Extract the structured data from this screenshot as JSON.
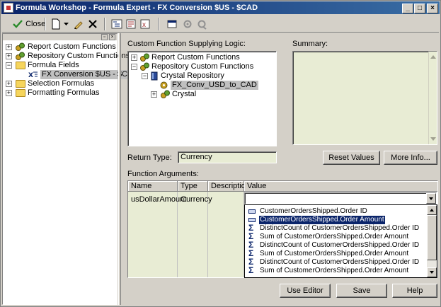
{
  "window": {
    "title": "Formula Workshop - Formula Expert - FX Conversion $US - $CAD",
    "minimize": "_",
    "maximize": "□",
    "close": "×"
  },
  "toolbar": {
    "close_label": "Close"
  },
  "left_tree": [
    {
      "label": "Report Custom Functions",
      "expander": "+",
      "icon": "functions-icon"
    },
    {
      "label": "Repository Custom Functions",
      "expander": "+",
      "icon": "functions-icon"
    },
    {
      "label": "Formula Fields",
      "expander": "−",
      "icon": "folder-icon"
    },
    {
      "label": "FX Conversion $US - $CAD",
      "expander": "",
      "icon": "formula-icon",
      "selected": true
    },
    {
      "label": "Selection Formulas",
      "expander": "+",
      "icon": "folder-icon"
    },
    {
      "label": "Formatting Formulas",
      "expander": "+",
      "icon": "folder-icon"
    }
  ],
  "cf_panel": {
    "label": "Custom Function Supplying Logic:",
    "tree": [
      {
        "label": "Report Custom Functions",
        "expander": "+"
      },
      {
        "label": "Repository Custom Functions",
        "expander": "−"
      },
      {
        "label": "Crystal Repository",
        "expander": "−"
      },
      {
        "label": "FX_Conv_USD_to_CAD",
        "expander": "",
        "selected": true
      },
      {
        "label": "Crystal",
        "expander": "+"
      }
    ]
  },
  "summary": {
    "label": "Summary:"
  },
  "return_type": {
    "label": "Return Type:",
    "value": "Currency"
  },
  "buttons": {
    "reset_values": "Reset Values",
    "more_info": "More Info...",
    "use_editor": "Use Editor",
    "save": "Save",
    "help": "Help"
  },
  "function_arguments": {
    "label": "Function Arguments:",
    "columns": [
      "Name",
      "Type",
      "Description",
      "Value"
    ],
    "rows": [
      {
        "name": "usDollarAmount",
        "type": "Currency",
        "description": "",
        "value": ""
      }
    ]
  },
  "dropdown_items": [
    {
      "icon": "field-icon",
      "text": "CustomerOrdersShipped.Order ID"
    },
    {
      "icon": "field-icon",
      "text": "CustomerOrdersShipped.Order Amount",
      "highlighted": true
    },
    {
      "icon": "sigma-icon",
      "text": "DistinctCount of CustomerOrdersShipped.Order ID"
    },
    {
      "icon": "sigma-icon",
      "text": "Sum of CustomerOrdersShipped.Order Amount"
    },
    {
      "icon": "sigma-icon",
      "text": "DistinctCount of CustomerOrdersShipped.Order ID"
    },
    {
      "icon": "sigma-icon",
      "text": "Sum of CustomerOrdersShipped.Order Amount"
    },
    {
      "icon": "sigma-icon",
      "text": "DistinctCount of CustomerOrdersShipped.Order ID"
    },
    {
      "icon": "sigma-icon",
      "text": "Sum of CustomerOrdersShipped.Order Amount"
    }
  ],
  "colors": {
    "title_start": "#0a246a",
    "title_end": "#3a6ea5",
    "summary_bg": "#e8ecd4",
    "selection": "#0a246a"
  }
}
